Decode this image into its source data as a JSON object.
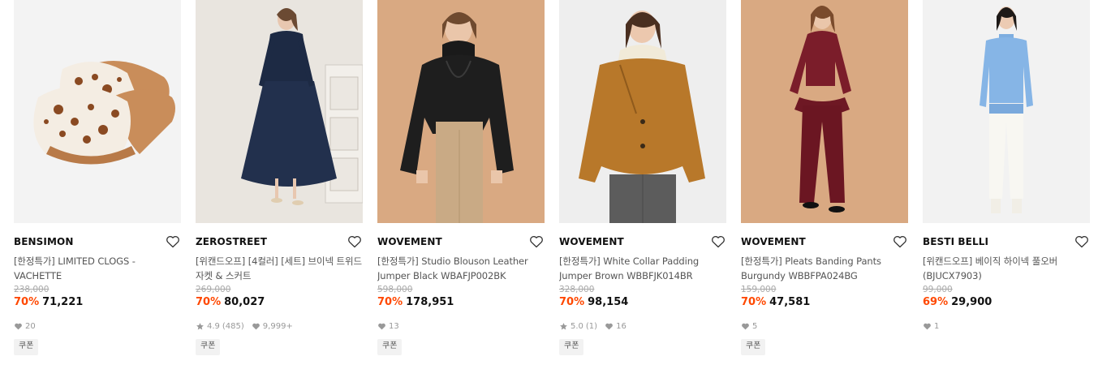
{
  "products": [
    {
      "brand": "BENSIMON",
      "title": "[한정특가] LIMITED CLOGS - VACHETTE",
      "original_price": "238,000",
      "discount": "70%",
      "price": "71,221",
      "rating": "",
      "review_count": "",
      "likes": "20",
      "coupon": "쿠폰",
      "image_desc": "spotted-clogs",
      "bg_color": "#f3f3f3"
    },
    {
      "brand": "ZEROSTREET",
      "title": "[위캔드오프] [4컬러] [세트] 브이넥 트위드 자켓 & 스커트",
      "original_price": "269,000",
      "discount": "70%",
      "price": "80,027",
      "rating": "4.9",
      "review_count": "(485)",
      "likes": "9,999+",
      "coupon": "쿠폰",
      "image_desc": "navy-tweed-dress",
      "bg_color": "#e9e5df"
    },
    {
      "brand": "WOVEMENT",
      "title": "[한정특가] Studio Blouson Leather Jumper Black WBAFJP002BK",
      "original_price": "598,000",
      "discount": "70%",
      "price": "178,951",
      "rating": "",
      "review_count": "",
      "likes": "13",
      "coupon": "쿠폰",
      "image_desc": "black-leather-jumper",
      "bg_color": "#d9a982"
    },
    {
      "brand": "WOVEMENT",
      "title": "[한정특가] White Collar Padding Jumper Brown WBBFJK014BR",
      "original_price": "328,000",
      "discount": "70%",
      "price": "98,154",
      "rating": "5.0",
      "review_count": "(1)",
      "likes": "16",
      "coupon": "쿠폰",
      "image_desc": "brown-padding-jumper",
      "bg_color": "#eeeeee"
    },
    {
      "brand": "WOVEMENT",
      "title": "[한정특가] Pleats Banding Pants Burgundy WBBFPA024BG",
      "original_price": "159,000",
      "discount": "70%",
      "price": "47,581",
      "rating": "",
      "review_count": "",
      "likes": "5",
      "coupon": "쿠폰",
      "image_desc": "burgundy-outfit",
      "bg_color": "#d9a982"
    },
    {
      "brand": "BESTI BELLI",
      "title": "[위캔드오프] 베이직 하이넥 풀오버 (BJUCX7903)",
      "original_price": "99,000",
      "discount": "69%",
      "price": "29,900",
      "rating": "",
      "review_count": "",
      "likes": "1",
      "coupon": "",
      "image_desc": "blue-knit-pullover",
      "bg_color": "#f2f2f2"
    }
  ],
  "colors": {
    "discount": "#ff4800",
    "brand_text": "#111111",
    "muted": "#999999"
  }
}
